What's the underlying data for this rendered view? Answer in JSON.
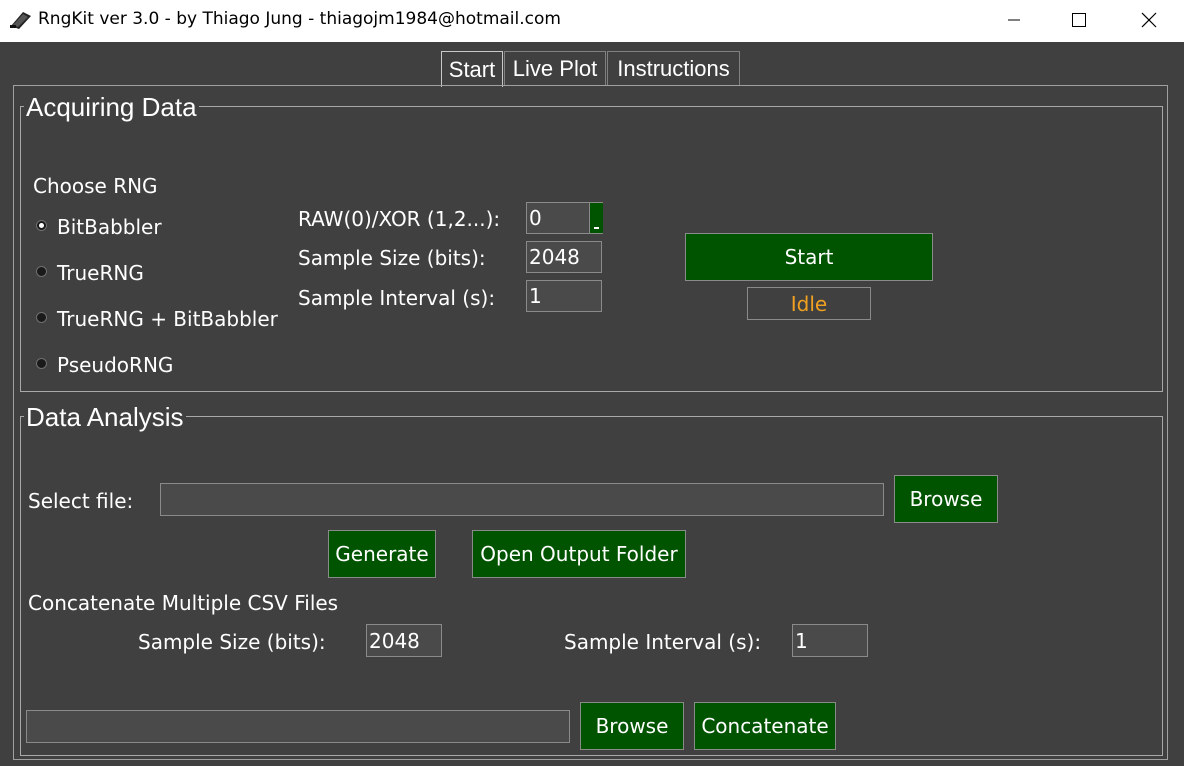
{
  "window": {
    "title": "RngKit ver 3.0 - by Thiago Jung - thiagojm1984@hotmail.com",
    "minimize_icon": "minimize-icon",
    "maximize_icon": "maximize-icon",
    "close_icon": "close-icon"
  },
  "tabs": [
    {
      "label": "Start",
      "active": true
    },
    {
      "label": "Live Plot",
      "active": false
    },
    {
      "label": "Instructions",
      "active": false
    }
  ],
  "acquiring": {
    "title": "Acquiring Data",
    "choose_label": "Choose RNG",
    "rng_options": [
      {
        "label": "BitBabbler",
        "selected": true
      },
      {
        "label": "TrueRNG",
        "selected": false
      },
      {
        "label": "TrueRNG + BitBabbler",
        "selected": false
      },
      {
        "label": "PseudoRNG",
        "selected": false
      }
    ],
    "xor_label": "RAW(0)/XOR (1,2...):",
    "xor_value": "0",
    "sample_size_label": "Sample Size (bits):",
    "sample_size_value": "2048",
    "sample_interval_label": "Sample Interval (s):",
    "sample_interval_value": "1",
    "start_label": "Start",
    "status": "Idle",
    "status_color": "#f0a020"
  },
  "analysis": {
    "title": "Data Analysis",
    "select_file_label": "Select file:",
    "select_file_value": "",
    "browse_label": "Browse",
    "generate_label": "Generate",
    "open_folder_label": "Open Output Folder",
    "concat_title": "Concatenate Multiple CSV Files",
    "concat_sample_size_label": "Sample Size (bits):",
    "concat_sample_size_value": "2048",
    "concat_interval_label": "Sample Interval (s):",
    "concat_interval_value": "1",
    "concat_file_value": "",
    "concat_browse_label": "Browse",
    "concatenate_label": "Concatenate"
  },
  "colors": {
    "background": "#404040",
    "button": "#005400",
    "accent_status": "#f0a020"
  }
}
